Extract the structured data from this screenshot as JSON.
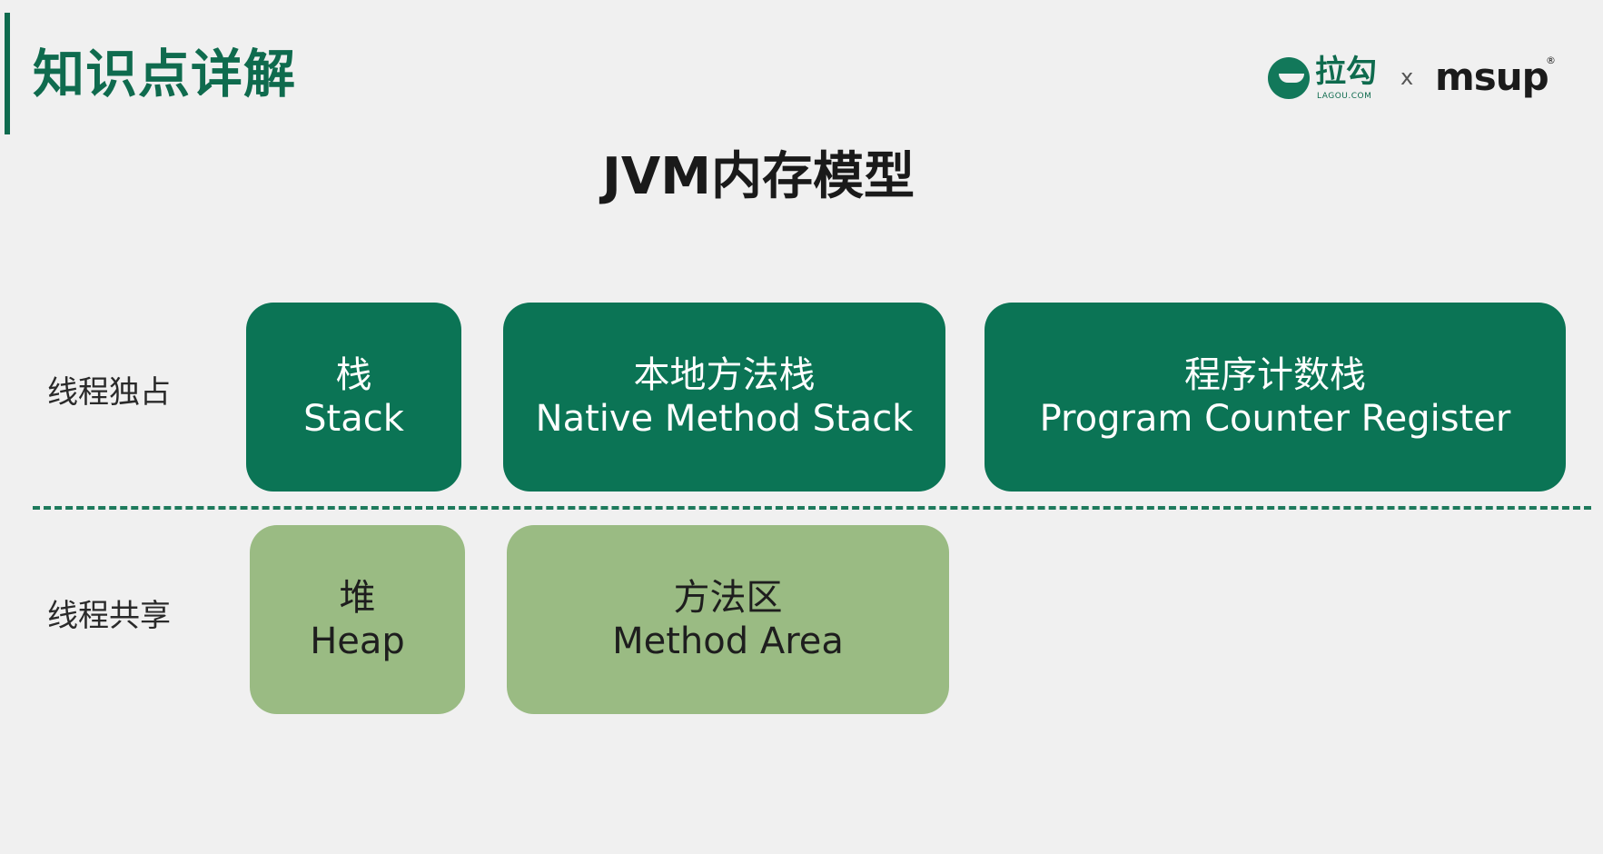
{
  "header": {
    "section_title": "知识点详解",
    "logos": {
      "lagou": "拉勾",
      "lagou_sub": "LAGOU.COM",
      "separator": "x",
      "msup": "msup",
      "msup_mark": "®"
    }
  },
  "diagram": {
    "title": "JVM内存模型",
    "rows": [
      {
        "label": "线程独占",
        "areas": [
          {
            "zh": "栈",
            "en": "Stack"
          },
          {
            "zh": "本地方法栈",
            "en": "Native Method Stack"
          },
          {
            "zh": "程序计数栈",
            "en": "Program Counter Register"
          }
        ]
      },
      {
        "label": "线程共享",
        "areas": [
          {
            "zh": "堆",
            "en": "Heap"
          },
          {
            "zh": "方法区",
            "en": "Method Area"
          }
        ]
      }
    ]
  },
  "colors": {
    "brand_green": "#0f6b4e",
    "private_box": "#0b7455",
    "shared_box": "#9abb83"
  }
}
